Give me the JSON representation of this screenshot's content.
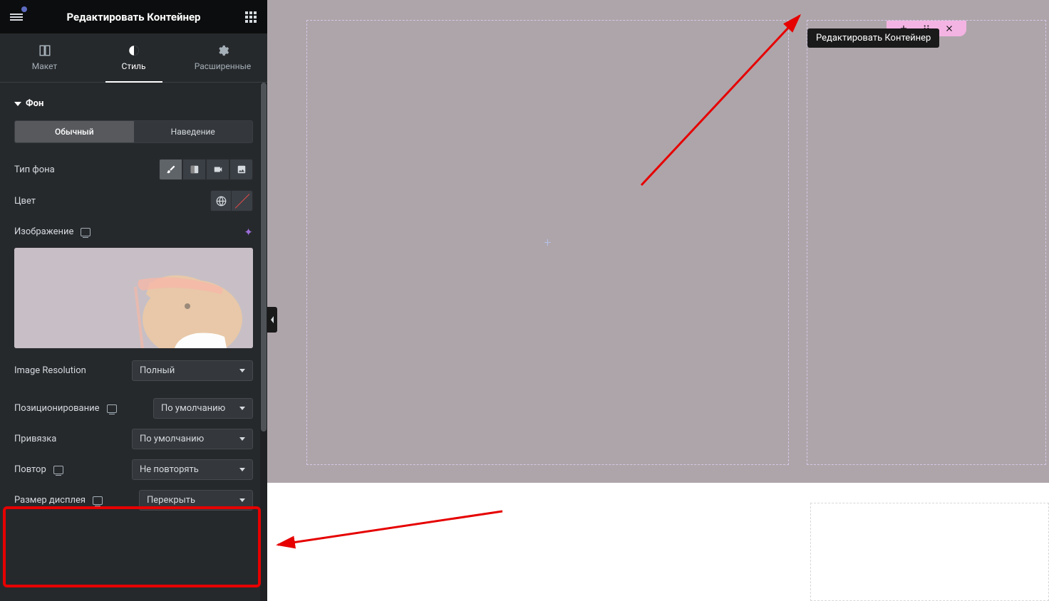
{
  "header": {
    "title": "Редактировать Контейнер"
  },
  "tabs": {
    "layout": "Макет",
    "style": "Стиль",
    "advanced": "Расширенные"
  },
  "section": {
    "background": "Фон"
  },
  "subtabs": {
    "normal": "Обычный",
    "hover": "Наведение"
  },
  "bgType": {
    "label": "Тип фона"
  },
  "color": {
    "label": "Цвет"
  },
  "image": {
    "label": "Изображение"
  },
  "resolution": {
    "label": "Image Resolution",
    "value": "Полный"
  },
  "position": {
    "label": "Позиционирование",
    "value": "По умолчанию"
  },
  "attachment": {
    "label": "Привязка",
    "value": "По умолчанию"
  },
  "repeat": {
    "label": "Повтор",
    "value": "Не повторять"
  },
  "display": {
    "label": "Размер дисплея",
    "value": "Перекрыть"
  },
  "tooltip": {
    "text": "Редактировать Контейнер"
  }
}
